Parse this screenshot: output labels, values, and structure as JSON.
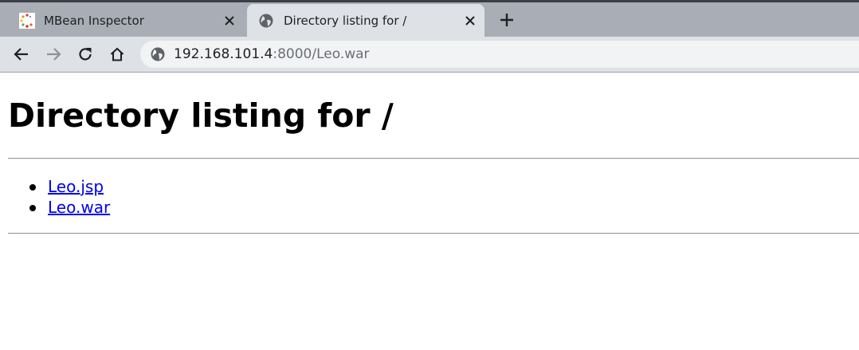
{
  "tabs": [
    {
      "title": "MBean Inspector",
      "favicon": "mbean-inspector-favicon",
      "active": false
    },
    {
      "title": "Directory listing for /",
      "favicon": "globe-icon",
      "active": true
    }
  ],
  "toolbar": {
    "url_host": "192.168.101.4",
    "url_rest": ":8000/Leo.war"
  },
  "page": {
    "heading": "Directory listing for /",
    "files": [
      "Leo.jsp",
      "Leo.war"
    ]
  },
  "colors": {
    "tabstrip": "#a9adb5",
    "active_tab": "#dee1e6",
    "link": "#0000ee"
  }
}
